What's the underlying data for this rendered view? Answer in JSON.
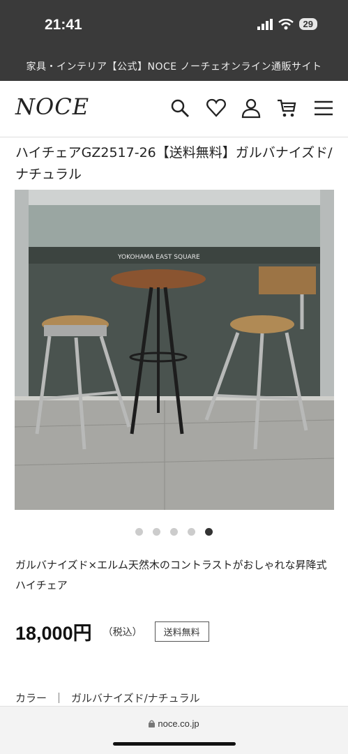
{
  "status_bar": {
    "time": "21:41",
    "battery": "29"
  },
  "site_bar": {
    "text": "家具・インテリア【公式】NOCE ノーチェオンライン通販サイト"
  },
  "header": {
    "logo": "NOCE",
    "icons": [
      "search-icon",
      "heart-icon",
      "user-icon",
      "cart-icon",
      "menu-icon"
    ]
  },
  "product": {
    "title": "ハイチェアGZ2517-26【送料無料】ガルバナイズド/ナチュラル",
    "image_alt": "",
    "signage": "YOKOHAMA EAST SQUARE",
    "carousel": {
      "count": 5,
      "active_index": 4
    },
    "description": "ガルバナイズド×エルム天然木のコントラストがおしゃれな昇降式ハイチェア",
    "price": "18,000円",
    "tax_note": "（税込）",
    "shipping_badge": "送料無料",
    "color_label": "カラー",
    "color_separator": "｜",
    "color_value": "ガルバナイズド/ナチュラル"
  },
  "browser": {
    "url": "noce.co.jp"
  },
  "colors": {
    "dark_bar": "#3a3a3a",
    "active_dot": "#333333",
    "inactive_dot": "#cccccc"
  }
}
